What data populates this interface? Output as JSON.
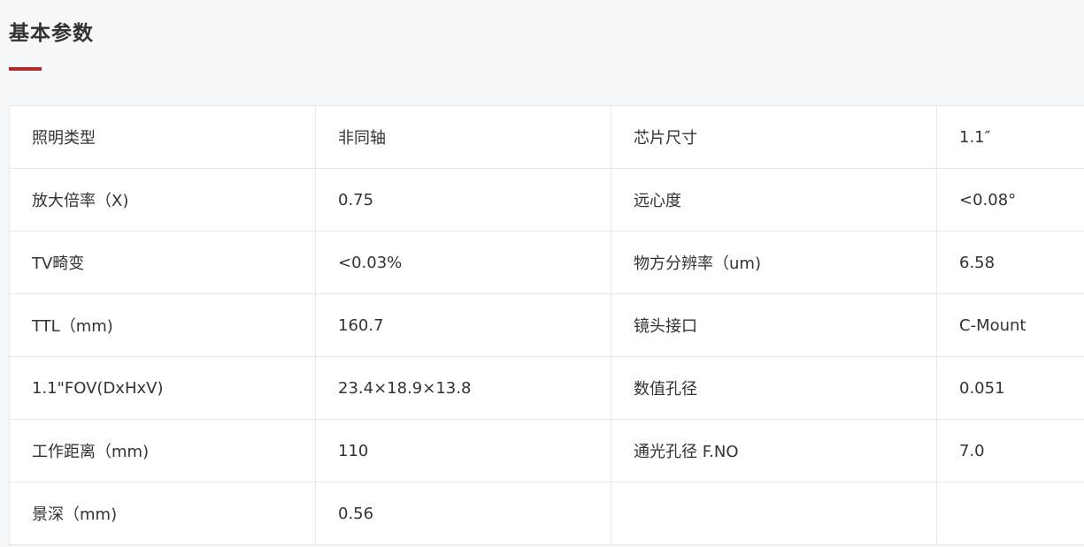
{
  "section": {
    "title": "基本参数",
    "accent_color": "#b5282b"
  },
  "params": {
    "rows": [
      [
        {
          "label": "照明类型",
          "value": "非同轴"
        },
        {
          "label": "芯片尺寸",
          "value": "1.1″"
        }
      ],
      [
        {
          "label": "放大倍率（X)",
          "value": "0.75"
        },
        {
          "label": "远心度",
          "value": "<0.08°"
        }
      ],
      [
        {
          "label": "TV畸变",
          "value": "<0.03%"
        },
        {
          "label": "物方分辨率（um)",
          "value": "6.58"
        }
      ],
      [
        {
          "label": "TTL（mm)",
          "value": "160.7"
        },
        {
          "label": "镜头接口",
          "value": "C-Mount"
        }
      ],
      [
        {
          "label": "1.1\"FOV(DxHxV)",
          "value": "23.4×18.9×13.8"
        },
        {
          "label": "数值孔径",
          "value": "0.051"
        }
      ],
      [
        {
          "label": "工作距离（mm)",
          "value": "110"
        },
        {
          "label": "通光孔径 F.NO",
          "value": "7.0"
        }
      ],
      [
        {
          "label": "景深（mm)",
          "value": "0.56"
        },
        {
          "label": "",
          "value": ""
        }
      ]
    ]
  }
}
